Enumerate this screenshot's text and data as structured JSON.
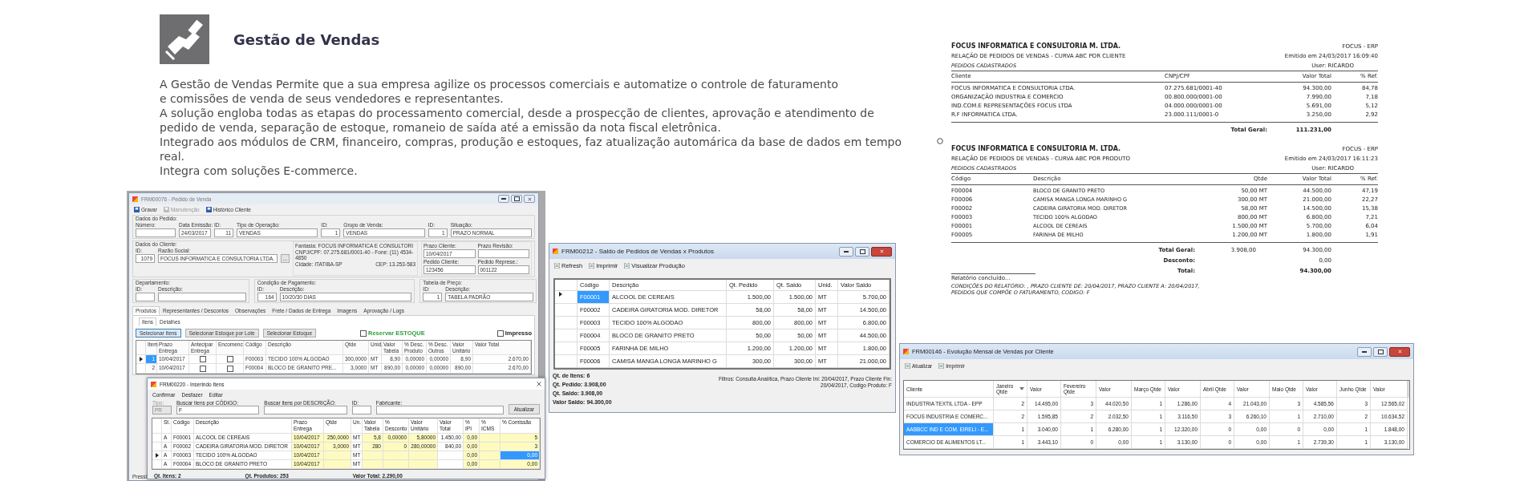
{
  "header": {
    "title": "Gestão de Vendas"
  },
  "intro_lines": [
    "A Gestão de Vendas Permite que a sua empresa agilize os processos comerciais e automatize o controle de faturamento",
    "e comissões de venda de seus vendedores e representantes.",
    "A solução engloba todas as etapas do processamento comercial, desde a prospecção de clientes, aprovação e atendimento de",
    "pedido de venda, separação de estoque, romaneio de saída até a emissão da nota fiscal eletrônica.",
    "Integrado aos módulos de CRM, financeiro, compras, produção e estoques, faz atualização automárica da base de dados em tempo",
    "real.",
    "Integra com soluções E-commerce."
  ],
  "order_window": {
    "title": "FRM00076 - Pedido de Venda",
    "toolbar": [
      {
        "label": "Gravar",
        "disabled": false
      },
      {
        "label": "Manutenção",
        "disabled": true
      },
      {
        "label": "Histórico Cliente",
        "disabled": false
      }
    ],
    "order_group": {
      "title": "Dados do Pedido:",
      "fields": [
        {
          "kind": "short",
          "label": "Número:"
        },
        {
          "kind": "date",
          "label": "Data Emissão:",
          "value": "24/03/2017"
        },
        {
          "kind": "id",
          "label": "ID:",
          "value": "11"
        },
        {
          "kind": "text",
          "label": "Tipo de Operação:",
          "value": "VENDAS"
        },
        {
          "kind": "id",
          "label": "ID:",
          "value": "1"
        },
        {
          "kind": "text",
          "label": "Grupo de Venda:",
          "value": "VENDAS"
        },
        {
          "kind": "id",
          "label": "ID:",
          "value": "1"
        },
        {
          "kind": "text",
          "label": "Situação:",
          "value": "PRAZO NORMAL"
        }
      ]
    },
    "client_group": {
      "title": "Dados do Cliente:",
      "fields": [
        {
          "kind": "id",
          "label": "ID:",
          "value": "1079"
        },
        {
          "kind": "text",
          "label": "Razão Social:",
          "value": "FOCUS INFORMATICA E CONSULTORIA LTDA."
        }
      ],
      "lookup_button": "...",
      "info_lines": [
        "Fantasia: FOCUS INFORMATICA E CONSULTORI",
        "CNPJ/CPF: 07.275.681/0001-40  -  Fone: (11) 4534-4850"
      ],
      "city": "Cidade: ITATIBA-SP",
      "zip": "CEP: 13.253-583",
      "extra_fields": [
        {
          "label": "Prazo Cliente:",
          "value": "10/04/2017"
        },
        {
          "label": "Prazo Revisão:"
        },
        {
          "label": "Pedido Cliente:",
          "value": "123456"
        },
        {
          "label": "Pedido Represe.:",
          "value": "001122"
        }
      ]
    },
    "groups": [
      {
        "title": "Departamento:",
        "fields": [
          {
            "kind": "id",
            "label": "ID:"
          },
          {
            "kind": "text",
            "label": "Descrição:"
          }
        ]
      },
      {
        "title": "Condição de Pagamento:",
        "fields": [
          {
            "kind": "id",
            "label": "ID:",
            "value": "164"
          },
          {
            "kind": "text",
            "label": "Descrição:",
            "value": "10/20/30 DIAS"
          }
        ]
      },
      {
        "title": "Tabela de Preço:",
        "fields": [
          {
            "kind": "id",
            "label": "ID:",
            "value": "1"
          },
          {
            "kind": "text",
            "label": "Descrição:",
            "value": "TABELA PADRÃO"
          }
        ]
      }
    ],
    "tabs": [
      {
        "label": "Produtos",
        "selected": true
      },
      {
        "label": "Representantes / Descontos",
        "selected": false
      },
      {
        "label": "Observações",
        "selected": false
      },
      {
        "label": "Frete / Dados de Entrega",
        "selected": false
      },
      {
        "label": "Imagens",
        "selected": false
      },
      {
        "label": "Aprovação / Logs",
        "selected": false
      }
    ],
    "subtabs": [
      {
        "label": "Itens",
        "selected": true
      },
      {
        "label": "Detalhes",
        "selected": false
      }
    ],
    "buttons": [
      {
        "label": "Selecionar Itens",
        "selected": true
      },
      {
        "label": "Selecionar Estoque por Lote",
        "selected": false
      },
      {
        "label": "Selecionar Estoque",
        "selected": false
      }
    ],
    "checkboxes": [
      {
        "label": "Reservar ESTOQUE",
        "checked": false,
        "color": "#2e9e3e"
      },
      {
        "label": "Impresso",
        "checked": false,
        "color": "#222222"
      }
    ],
    "columns": [
      "Item",
      "Prazo Entrega",
      "Antecipar Entrega",
      "Encomenc",
      "Código",
      "Descrição",
      "Qtde",
      "Unid.",
      "Valor Tabela",
      "% Desc. Produto",
      "% Desc. Outros",
      "Valor Unitário",
      "Valor Total"
    ],
    "rows": [
      {
        "selected": true,
        "item": "1",
        "due": "10/04/2017",
        "advance": false,
        "custom": false,
        "code": "F00003",
        "description": "TECIDO 100% ALGODAO",
        "qty": "300,0000",
        "unit": "MT",
        "list_price": "8,90",
        "product_discount": "0,00000",
        "other_discount": "0,00000",
        "unit_price": "8,90",
        "total": "2.670,00"
      },
      {
        "selected": false,
        "item": "2",
        "due": "10/04/2017",
        "advance": false,
        "custom": false,
        "code": "F00004",
        "description": "BLOCO DE GRANITO PRE...",
        "qty": "3,0000",
        "unit": "MT",
        "list_price": "890,00",
        "product_discount": "0,00000",
        "other_discount": "0,00000",
        "unit_price": "890,00",
        "total": "2.670,00"
      }
    ],
    "status": "Pressi"
  },
  "insert_window": {
    "title": "FRM00220 - Inserindo Itens",
    "toolbar": [
      "Confirmar",
      "Desfazer",
      "Editar"
    ],
    "filters": [
      {
        "kind": "combo",
        "label": "Tipo:",
        "value": "PR",
        "disabled": true
      },
      {
        "kind": "text",
        "label": "Buscar itens por CÓDIGO:",
        "value": "F",
        "disabled": false
      },
      {
        "kind": "text",
        "label": "Buscar itens por DESCRIÇÃO:",
        "disabled": false
      },
      {
        "kind": "id",
        "label": "ID:",
        "disabled": false
      },
      {
        "kind": "wide",
        "label": "Fabricante:",
        "disabled": false
      }
    ],
    "refresh_button": "Atualizar",
    "columns": [
      {
        "label": "St.",
        "editable": false
      },
      {
        "label": "Código",
        "editable": false
      },
      {
        "label": "Descrição",
        "editable": false
      },
      {
        "label": "Prazo Entrega",
        "editable": true
      },
      {
        "label": "Qtde",
        "editable": true
      },
      {
        "label": "Un.",
        "editable": false
      },
      {
        "label": "Valor Tabela",
        "editable": true
      },
      {
        "label": "% Desconto",
        "editable": true
      },
      {
        "label": "Valor Unitário",
        "editable": true
      },
      {
        "label": "Valor Total",
        "editable": false
      },
      {
        "label": "% IPI",
        "editable": true
      },
      {
        "label": "% ICMS",
        "editable": true
      },
      {
        "label": "% Comissão",
        "editable": true
      }
    ],
    "rows": [
      {
        "selected": false,
        "cells": [
          "A",
          "F00001",
          "ALCOOL DE CEREAIS",
          "10/04/2017",
          "250,0000",
          "MT",
          "5,8",
          "0,00000",
          "5,80000",
          "1.450,00",
          "0,00",
          null,
          "5"
        ]
      },
      {
        "selected": false,
        "cells": [
          "A",
          "F00002",
          "CADEIRA GIRATORIA MOD. DIRETOR",
          "10/04/2017",
          "3,0000",
          "MT",
          "280",
          "0",
          "280,00000",
          "840,00",
          "0,00",
          null,
          "3"
        ]
      },
      {
        "selected": true,
        "cells": [
          "A",
          "F00003",
          "TECIDO 100% ALGODAO",
          "10/04/2017",
          null,
          "MT",
          null,
          null,
          null,
          null,
          "0,00",
          null,
          "0,00"
        ]
      },
      {
        "selected": false,
        "cells": [
          "A",
          "F00004",
          "BLOCO DE GRANITO PRETO",
          "10/04/2017",
          null,
          "MT",
          null,
          null,
          null,
          null,
          "0,00",
          null,
          "0,00"
        ]
      }
    ],
    "footer": [
      "Qt. Itens:  2",
      "Qt. Produtos:  253",
      "Valor Total:  2.290,00"
    ]
  },
  "balance_window": {
    "title": "FRM00212 - Saldo de Pedidos de Vendas x Produtos",
    "toolbar": [
      "Refresh",
      "Imprimir",
      "Visualizar Produção"
    ],
    "columns": [
      "Código",
      "Descrição",
      "Qt. Pedido",
      "Qt. Saldo",
      "Unid.",
      "Valor Saldo"
    ],
    "rows": [
      {
        "selected": true,
        "cells": [
          "F00001",
          "ALCOOL DE CEREAIS",
          "1.500,00",
          "1.500,00",
          "MT",
          "5.700,00"
        ]
      },
      {
        "selected": false,
        "cells": [
          "F00002",
          "CADEIRA GIRATORIA MOD. DIRETOR",
          "58,00",
          "58,00",
          "MT",
          "14.500,00"
        ]
      },
      {
        "selected": false,
        "cells": [
          "F00003",
          "TECIDO 100% ALGODAO",
          "800,00",
          "800,00",
          "MT",
          "6.800,00"
        ]
      },
      {
        "selected": false,
        "cells": [
          "F00004",
          "BLOCO DE GRANITO PRETO",
          "50,00",
          "50,00",
          "MT",
          "44.500,00"
        ]
      },
      {
        "selected": false,
        "cells": [
          "F00005",
          "FARINHA DE MILHO",
          "1.200,00",
          "1.200,00",
          "MT",
          "1.800,00"
        ]
      },
      {
        "selected": false,
        "cells": [
          "F00006",
          "CAMISA MANGA LONGA MARINHO G",
          "300,00",
          "300,00",
          "MT",
          "21.000,00"
        ]
      }
    ],
    "summary": [
      "Qt. de Itens:  6",
      "Qt. Pedido:  3.908,00",
      "Qt. Saldo:  3.908,00",
      "Valor Saldo:  94.300,00"
    ],
    "filters": "Filtros:  Consulta Analítica, Prazo Cliente Ini: 20/04/2017, Prazo Cliente Fin: 20/04/2017, Codigo Produto: F"
  },
  "report": {
    "sections": [
      {
        "kind": "client",
        "company": "FOCUS INFORMATICA E CONSULTORIA M. LTDA.",
        "system": "FOCUS - ERP",
        "title": "RELAÇÃO DE PEDIDOS DE VENDAS - CURVA ABC POR CLIENTE",
        "issued": "Emitido em 24/03/2017 16:09:40",
        "subtitle": "PEDIDOS CADASTRADOS",
        "user": "User: RICARDO",
        "columns": [
          "Cliente",
          "CNPJ/CPF",
          "Valor Total",
          "% Ref."
        ],
        "rows": [
          [
            "FOCUS INFORMATICA E CONSULTORIA LTDA.",
            "07.275.681/0001-40",
            "94.300,00",
            "84,78"
          ],
          [
            "ORGANIZAÇÃO INDUSTRIA E COMERCIO",
            "00.800.000/0001-00",
            "7.990,00",
            "7,18"
          ],
          [
            "IND.COM.E REPRESENTAÇÕES FOCUS LTDA",
            "04.000.000/0001-00",
            "5.691,00",
            "5,12"
          ],
          [
            "R.F INFORMATICA LTDA.",
            "23.000.111/0001-0",
            "3.250,00",
            "2,92"
          ]
        ],
        "totals": [
          {
            "label": "Total Geral:",
            "value": "111.231,00"
          }
        ]
      },
      {
        "kind": "product",
        "company": "FOCUS INFORMATICA E CONSULTORIA M. LTDA.",
        "system": "FOCUS - ERP",
        "title": "RELAÇÃO DE PEDIDOS DE VENDAS - CURVA ABC POR PRODUTO",
        "issued": "Emitido em 24/03/2017 16:11:23",
        "subtitle": "PEDIDOS CADASTRADOS",
        "user": "User: RICARDO",
        "columns": [
          "Código",
          "Descrição",
          "Qtde",
          "Valor Total",
          "% Ref."
        ],
        "rows": [
          [
            "F00004",
            "BLOCO DE GRANITO PRETO",
            "50,00 MT",
            "44.500,00",
            "47,19"
          ],
          [
            "F00006",
            "CAMISA MANGA LONGA MARINHO G",
            "300,00 MT",
            "21.000,00",
            "22,27"
          ],
          [
            "F00002",
            "CADEIRA GIRATORIA MOD. DIRETOR",
            "58,00 MT",
            "14.500,00",
            "15,38"
          ],
          [
            "F00003",
            "TECIDO 100% ALGODAO",
            "800,00 MT",
            "6.800,00",
            "7,21"
          ],
          [
            "F00001",
            "ALCOOL DE CEREAIS",
            "1.500,00 MT",
            "5.700,00",
            "6,04"
          ],
          [
            "F00005",
            "FARINHA DE MILHO",
            "1.200,00 MT",
            "1.800,00",
            "1,91"
          ]
        ],
        "totals": [
          {
            "label": "Total Geral:",
            "qty": "3.908,00",
            "value": "94.300,00"
          },
          {
            "label": "Desconto:",
            "value": "0,00"
          },
          {
            "label": "Total:",
            "value": "94.300,00"
          }
        ]
      }
    ],
    "status": "Relatório concluído...",
    "conditions": [
      "CONDIÇÕES DO RELATÓRIO: , PRAZO CLIENTE DE: 20/04/2017, PRAZO CLIENTE A: 20/04/2017,",
      "PEDIDOS QUE COMPÕE O FATURAMENTO, CODIGO: F"
    ]
  },
  "evolution_window": {
    "title": "FRM00146 - Evolução Mensal de Vendas por Cliente",
    "toolbar": [
      "Atualizar",
      "Imprimir"
    ],
    "columns": [
      {
        "label": "Cliente",
        "sorted": false
      },
      {
        "label": "Janeiro Qtde",
        "sorted": true
      },
      {
        "label": "Valor",
        "sorted": false
      },
      {
        "label": "Fevereiro Qtde",
        "sorted": false
      },
      {
        "label": "Valor",
        "sorted": false
      },
      {
        "label": "Março Qtde",
        "sorted": false
      },
      {
        "label": "Valor",
        "sorted": false
      },
      {
        "label": "Abril Qtde",
        "sorted": false
      },
      {
        "label": "Valor",
        "sorted": false
      },
      {
        "label": "Maio Qtde",
        "sorted": false
      },
      {
        "label": "Valor",
        "sorted": false
      },
      {
        "label": "Junho Qtde",
        "sorted": false
      },
      {
        "label": "Valor",
        "sorted": false
      }
    ],
    "rows": [
      {
        "selected": false,
        "cells": [
          "INDUSTRIA TEXTIL LTDA - EPP",
          "2",
          "14.495,00",
          "3",
          "44.020,50",
          "1",
          "1.286,00",
          "4",
          "21.043,00",
          "3",
          "4.585,56",
          "3",
          "12.565,02"
        ]
      },
      {
        "selected": false,
        "cells": [
          "FOCUS INDUSTRIA E COMERC...",
          "2",
          "1.595,85",
          "2",
          "2.032,50",
          "1",
          "3.116,50",
          "3",
          "6.260,10",
          "1",
          "2.710,00",
          "2",
          "10.634,52"
        ]
      },
      {
        "selected": true,
        "cells": [
          "AABBCC IND E COM. EIRELI - E...",
          "1",
          "3.040,00",
          "1",
          "6.280,00",
          "1",
          "12.320,00",
          "0",
          "0,00",
          "0",
          "0,00",
          "1",
          "1.848,00"
        ]
      },
      {
        "selected": false,
        "cells": [
          "COMERCIO DE ALIMENTOS LT...",
          "1",
          "3.443,10",
          "0",
          "0,00",
          "1",
          "3.130,00",
          "0",
          "0,00",
          "1",
          "2.739,30",
          "1",
          "3.130,00"
        ]
      }
    ]
  }
}
